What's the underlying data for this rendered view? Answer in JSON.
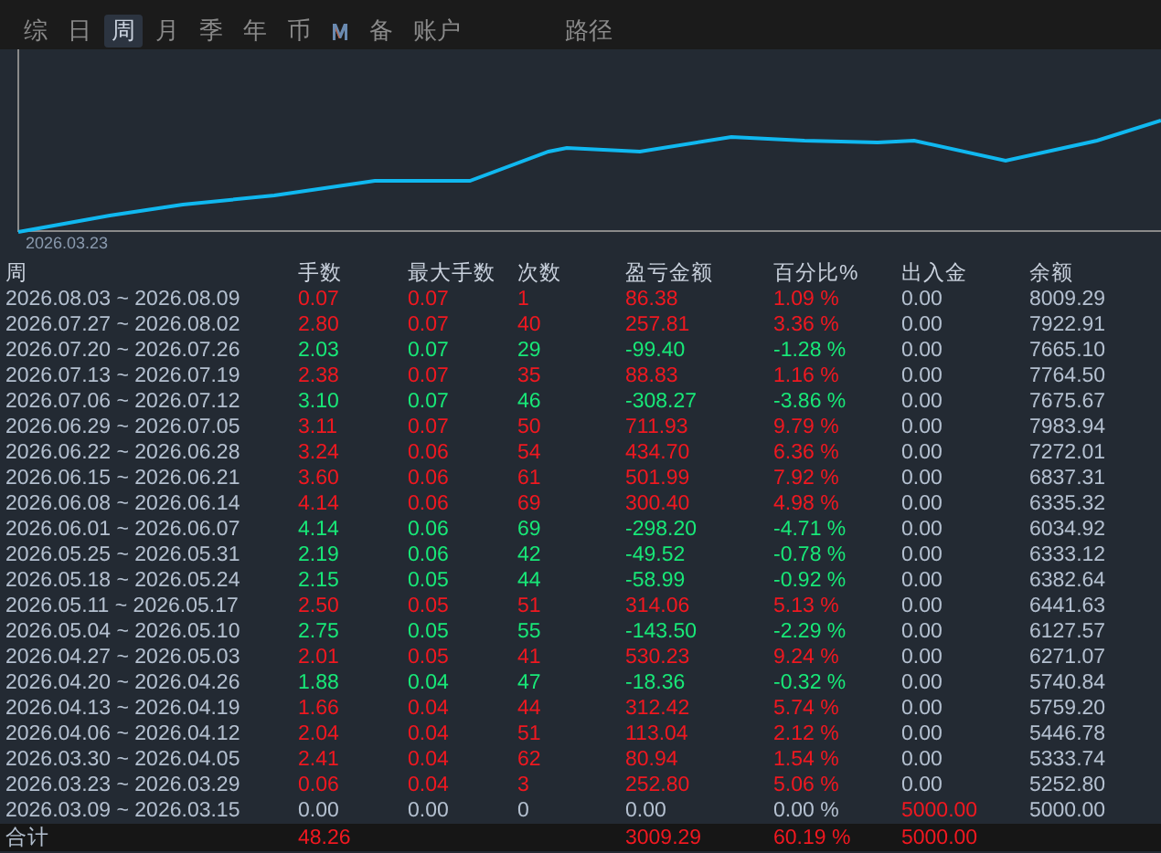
{
  "tabs": [
    {
      "label": "综",
      "selected": false
    },
    {
      "label": "日",
      "selected": false
    },
    {
      "label": "周",
      "selected": true
    },
    {
      "label": "月",
      "selected": false
    },
    {
      "label": "季",
      "selected": false
    },
    {
      "label": "年",
      "selected": false
    },
    {
      "label": "币",
      "selected": false
    },
    {
      "kind": "icon",
      "selected": false
    },
    {
      "label": "备",
      "selected": false
    },
    {
      "label": "账户",
      "selected": false
    },
    {
      "label": "路径",
      "selected": false,
      "kind": "far"
    }
  ],
  "chart": {
    "start_label": "2026.03.23"
  },
  "table": {
    "columns": [
      "周",
      "手数",
      "最大手数",
      "次数",
      "盈亏金额",
      "百分比%",
      "出入金",
      "余额"
    ],
    "rows": [
      {
        "week": "2026.08.03 ~ 2026.08.09",
        "lots": "0.07",
        "max_lots": "0.07",
        "count": "1",
        "pnl": "86.38",
        "pct": "1.09 %",
        "deposit": "0.00",
        "balance": "8009.29",
        "kind": "gain",
        "deposit_flagged": false
      },
      {
        "week": "2026.07.27 ~ 2026.08.02",
        "lots": "2.80",
        "max_lots": "0.07",
        "count": "40",
        "pnl": "257.81",
        "pct": "3.36 %",
        "deposit": "0.00",
        "balance": "7922.91",
        "kind": "gain",
        "deposit_flagged": false
      },
      {
        "week": "2026.07.20 ~ 2026.07.26",
        "lots": "2.03",
        "max_lots": "0.07",
        "count": "29",
        "pnl": "-99.40",
        "pct": "-1.28 %",
        "deposit": "0.00",
        "balance": "7665.10",
        "kind": "loss",
        "deposit_flagged": false
      },
      {
        "week": "2026.07.13 ~ 2026.07.19",
        "lots": "2.38",
        "max_lots": "0.07",
        "count": "35",
        "pnl": "88.83",
        "pct": "1.16 %",
        "deposit": "0.00",
        "balance": "7764.50",
        "kind": "gain",
        "deposit_flagged": false
      },
      {
        "week": "2026.07.06 ~ 2026.07.12",
        "lots": "3.10",
        "max_lots": "0.07",
        "count": "46",
        "pnl": "-308.27",
        "pct": "-3.86 %",
        "deposit": "0.00",
        "balance": "7675.67",
        "kind": "loss",
        "deposit_flagged": false
      },
      {
        "week": "2026.06.29 ~ 2026.07.05",
        "lots": "3.11",
        "max_lots": "0.07",
        "count": "50",
        "pnl": "711.93",
        "pct": "9.79 %",
        "deposit": "0.00",
        "balance": "7983.94",
        "kind": "gain",
        "deposit_flagged": false
      },
      {
        "week": "2026.06.22 ~ 2026.06.28",
        "lots": "3.24",
        "max_lots": "0.06",
        "count": "54",
        "pnl": "434.70",
        "pct": "6.36 %",
        "deposit": "0.00",
        "balance": "7272.01",
        "kind": "gain",
        "deposit_flagged": false
      },
      {
        "week": "2026.06.15 ~ 2026.06.21",
        "lots": "3.60",
        "max_lots": "0.06",
        "count": "61",
        "pnl": "501.99",
        "pct": "7.92 %",
        "deposit": "0.00",
        "balance": "6837.31",
        "kind": "gain",
        "deposit_flagged": false
      },
      {
        "week": "2026.06.08 ~ 2026.06.14",
        "lots": "4.14",
        "max_lots": "0.06",
        "count": "69",
        "pnl": "300.40",
        "pct": "4.98 %",
        "deposit": "0.00",
        "balance": "6335.32",
        "kind": "gain",
        "deposit_flagged": false
      },
      {
        "week": "2026.06.01 ~ 2026.06.07",
        "lots": "4.14",
        "max_lots": "0.06",
        "count": "69",
        "pnl": "-298.20",
        "pct": "-4.71 %",
        "deposit": "0.00",
        "balance": "6034.92",
        "kind": "loss",
        "deposit_flagged": false
      },
      {
        "week": "2026.05.25 ~ 2026.05.31",
        "lots": "2.19",
        "max_lots": "0.06",
        "count": "42",
        "pnl": "-49.52",
        "pct": "-0.78 %",
        "deposit": "0.00",
        "balance": "6333.12",
        "kind": "loss",
        "deposit_flagged": false
      },
      {
        "week": "2026.05.18 ~ 2026.05.24",
        "lots": "2.15",
        "max_lots": "0.05",
        "count": "44",
        "pnl": "-58.99",
        "pct": "-0.92 %",
        "deposit": "0.00",
        "balance": "6382.64",
        "kind": "loss",
        "deposit_flagged": false
      },
      {
        "week": "2026.05.11 ~ 2026.05.17",
        "lots": "2.50",
        "max_lots": "0.05",
        "count": "51",
        "pnl": "314.06",
        "pct": "5.13 %",
        "deposit": "0.00",
        "balance": "6441.63",
        "kind": "gain",
        "deposit_flagged": false
      },
      {
        "week": "2026.05.04 ~ 2026.05.10",
        "lots": "2.75",
        "max_lots": "0.05",
        "count": "55",
        "pnl": "-143.50",
        "pct": "-2.29 %",
        "deposit": "0.00",
        "balance": "6127.57",
        "kind": "loss",
        "deposit_flagged": false
      },
      {
        "week": "2026.04.27 ~ 2026.05.03",
        "lots": "2.01",
        "max_lots": "0.05",
        "count": "41",
        "pnl": "530.23",
        "pct": "9.24 %",
        "deposit": "0.00",
        "balance": "6271.07",
        "kind": "gain",
        "deposit_flagged": false
      },
      {
        "week": "2026.04.20 ~ 2026.04.26",
        "lots": "1.88",
        "max_lots": "0.04",
        "count": "47",
        "pnl": "-18.36",
        "pct": "-0.32 %",
        "deposit": "0.00",
        "balance": "5740.84",
        "kind": "loss",
        "deposit_flagged": false
      },
      {
        "week": "2026.04.13 ~ 2026.04.19",
        "lots": "1.66",
        "max_lots": "0.04",
        "count": "44",
        "pnl": "312.42",
        "pct": "5.74 %",
        "deposit": "0.00",
        "balance": "5759.20",
        "kind": "gain",
        "deposit_flagged": false
      },
      {
        "week": "2026.04.06 ~ 2026.04.12",
        "lots": "2.04",
        "max_lots": "0.04",
        "count": "51",
        "pnl": "113.04",
        "pct": "2.12 %",
        "deposit": "0.00",
        "balance": "5446.78",
        "kind": "gain",
        "deposit_flagged": false
      },
      {
        "week": "2026.03.30 ~ 2026.04.05",
        "lots": "2.41",
        "max_lots": "0.04",
        "count": "62",
        "pnl": "80.94",
        "pct": "1.54 %",
        "deposit": "0.00",
        "balance": "5333.74",
        "kind": "gain",
        "deposit_flagged": false
      },
      {
        "week": "2026.03.23 ~ 2026.03.29",
        "lots": "0.06",
        "max_lots": "0.04",
        "count": "3",
        "pnl": "252.80",
        "pct": "5.06 %",
        "deposit": "0.00",
        "balance": "5252.80",
        "kind": "gain",
        "deposit_flagged": false
      },
      {
        "week": "2026.03.09 ~ 2026.03.15",
        "lots": "0.00",
        "max_lots": "0.00",
        "count": "0",
        "pnl": "0.00",
        "pct": "0.00 %",
        "deposit": "5000.00",
        "balance": "5000.00",
        "kind": "flat",
        "deposit_flagged": true
      }
    ],
    "total": {
      "label": "合计",
      "lots": "48.26",
      "pnl": "3009.29",
      "pct": "60.19 %",
      "deposit": "5000.00"
    }
  }
}
